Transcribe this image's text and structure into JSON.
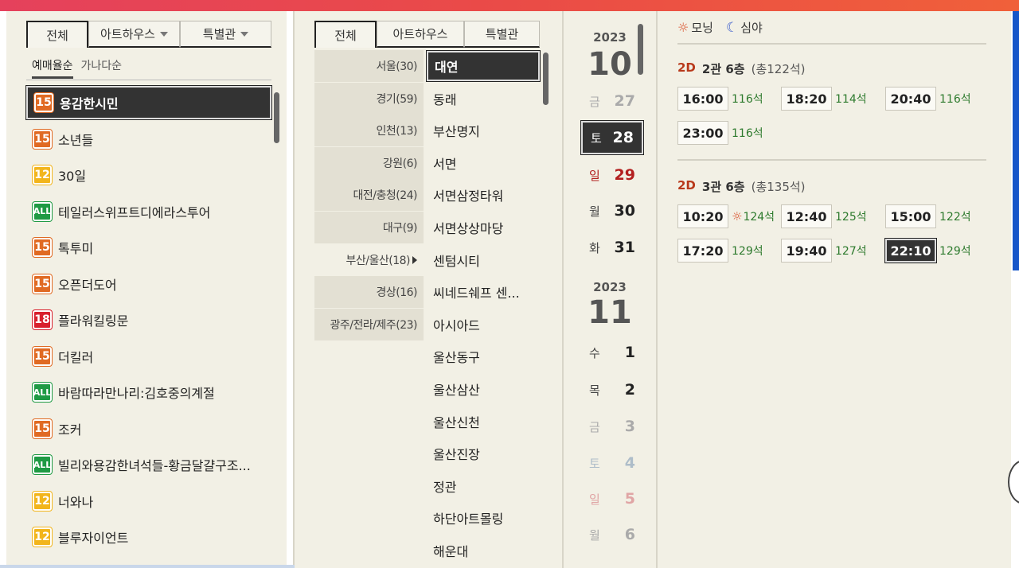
{
  "movie_panel": {
    "tabs": [
      {
        "label": "전체",
        "dropdown": false
      },
      {
        "label": "아트하우스",
        "dropdown": true
      },
      {
        "label": "특별관",
        "dropdown": true
      }
    ],
    "sort": [
      {
        "label": "예매율순"
      },
      {
        "label": "가나다순"
      }
    ],
    "movies": [
      {
        "rating": "15",
        "title": "용감한시민"
      },
      {
        "rating": "15",
        "title": "소년들"
      },
      {
        "rating": "12",
        "title": "30일"
      },
      {
        "rating": "ALL",
        "title": "테일러스위프트디에라스투어"
      },
      {
        "rating": "15",
        "title": "톡투미"
      },
      {
        "rating": "15",
        "title": "오픈더도어"
      },
      {
        "rating": "18",
        "title": "플라워킬링문"
      },
      {
        "rating": "15",
        "title": "더킬러"
      },
      {
        "rating": "ALL",
        "title": "바람따라만나리:김호중의계절"
      },
      {
        "rating": "15",
        "title": "조커"
      },
      {
        "rating": "ALL",
        "title": "빌리와용감한녀석들-황금달걀구조..."
      },
      {
        "rating": "12",
        "title": "너와나"
      },
      {
        "rating": "12",
        "title": "블루자이언트"
      }
    ]
  },
  "theater_panel": {
    "tabs": [
      {
        "label": "전체"
      },
      {
        "label": "아트하우스"
      },
      {
        "label": "특별관"
      }
    ],
    "regions": [
      {
        "label": "서울(30)"
      },
      {
        "label": "경기(59)"
      },
      {
        "label": "인천(13)"
      },
      {
        "label": "강원(6)"
      },
      {
        "label": "대전/충청(24)"
      },
      {
        "label": "대구(9)"
      },
      {
        "label": "부산/울산(18)"
      },
      {
        "label": "경상(16)"
      },
      {
        "label": "광주/전라/제주(23)"
      }
    ],
    "theaters": [
      {
        "label": "대연"
      },
      {
        "label": "동래"
      },
      {
        "label": "부산명지"
      },
      {
        "label": "서면"
      },
      {
        "label": "서면삼정타워"
      },
      {
        "label": "서면상상마당"
      },
      {
        "label": "센텀시티"
      },
      {
        "label": "씨네드쉐프 센..."
      },
      {
        "label": "아시아드"
      },
      {
        "label": "울산동구"
      },
      {
        "label": "울산삼산"
      },
      {
        "label": "울산신천"
      },
      {
        "label": "울산진장"
      },
      {
        "label": "정관"
      },
      {
        "label": "하단아트몰링"
      },
      {
        "label": "해운대"
      }
    ]
  },
  "date_panel": {
    "months": [
      {
        "year": "2023",
        "month": "10",
        "days": [
          {
            "wd": "금",
            "d": "27",
            "state": "dim"
          },
          {
            "wd": "토",
            "d": "28",
            "state": "selected"
          },
          {
            "wd": "일",
            "d": "29",
            "state": "sun"
          },
          {
            "wd": "월",
            "d": "30",
            "state": ""
          },
          {
            "wd": "화",
            "d": "31",
            "state": ""
          }
        ]
      },
      {
        "year": "2023",
        "month": "11",
        "days": [
          {
            "wd": "수",
            "d": "1",
            "state": ""
          },
          {
            "wd": "목",
            "d": "2",
            "state": ""
          },
          {
            "wd": "금",
            "d": "3",
            "state": "dim"
          },
          {
            "wd": "토",
            "d": "4",
            "state": "dim sat"
          },
          {
            "wd": "일",
            "d": "5",
            "state": "dim sun"
          },
          {
            "wd": "월",
            "d": "6",
            "state": "dim"
          }
        ]
      }
    ]
  },
  "time_panel": {
    "legend": {
      "morning": "모닝",
      "night": "심야"
    },
    "halls": [
      {
        "format": "2D",
        "name": "2관 6층",
        "capacity": "(총122석)",
        "slots": [
          {
            "time": "16:00",
            "seats": "116석",
            "morning": false,
            "selected": false
          },
          {
            "time": "18:20",
            "seats": "114석",
            "morning": false,
            "selected": false
          },
          {
            "time": "20:40",
            "seats": "116석",
            "morning": false,
            "selected": false
          },
          {
            "time": "23:00",
            "seats": "116석",
            "morning": false,
            "selected": false
          }
        ]
      },
      {
        "format": "2D",
        "name": "3관 6층",
        "capacity": "(총135석)",
        "slots": [
          {
            "time": "10:20",
            "seats": "124석",
            "morning": true,
            "selected": false
          },
          {
            "time": "12:40",
            "seats": "125석",
            "morning": false,
            "selected": false
          },
          {
            "time": "15:00",
            "seats": "122석",
            "morning": false,
            "selected": false
          },
          {
            "time": "17:20",
            "seats": "129석",
            "morning": false,
            "selected": false
          },
          {
            "time": "19:40",
            "seats": "127석",
            "morning": false,
            "selected": false
          },
          {
            "time": "22:10",
            "seats": "129석",
            "morning": false,
            "selected": true
          }
        ]
      }
    ]
  },
  "colors": {
    "rating_15": "#e06a23",
    "rating_12": "#f2b51c",
    "rating_18": "#d8202d",
    "rating_all": "#1f9a44",
    "selected_bg": "#333333"
  }
}
